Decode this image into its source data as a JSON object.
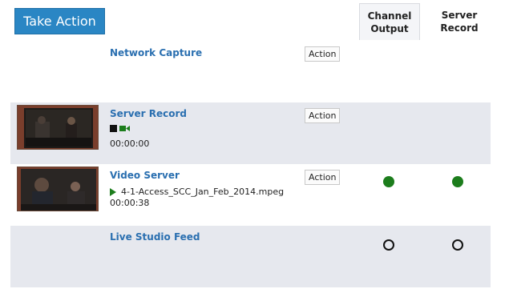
{
  "header": {
    "take_action_label": "Take Action",
    "columns": [
      {
        "label": "Channel\nOutput"
      },
      {
        "label": "Server\nRecord"
      }
    ]
  },
  "rows": [
    {
      "title": "Network Capture",
      "action_label": "Action",
      "has_thumbnail": false
    },
    {
      "title": "Server Record",
      "action_label": "Action",
      "timecode": "00:00:00",
      "icons": [
        "stop-icon",
        "camera-icon"
      ],
      "has_thumbnail": true
    },
    {
      "title": "Video Server",
      "action_label": "Action",
      "filename": "4-1-Access_SCC_Jan_Feb_2014.mpeg",
      "timecode": "00:00:38",
      "icons": [
        "play-icon"
      ],
      "channel_output": "on",
      "server_record": "on",
      "has_thumbnail": true
    },
    {
      "title": "Live Studio Feed",
      "channel_output": "off",
      "server_record": "off",
      "has_thumbnail": false
    }
  ],
  "colors": {
    "accent": "#2a86c4",
    "title_link": "#2a6fb0",
    "status_on": "#1c7d1c",
    "row_shade": "#e6e8ee"
  }
}
